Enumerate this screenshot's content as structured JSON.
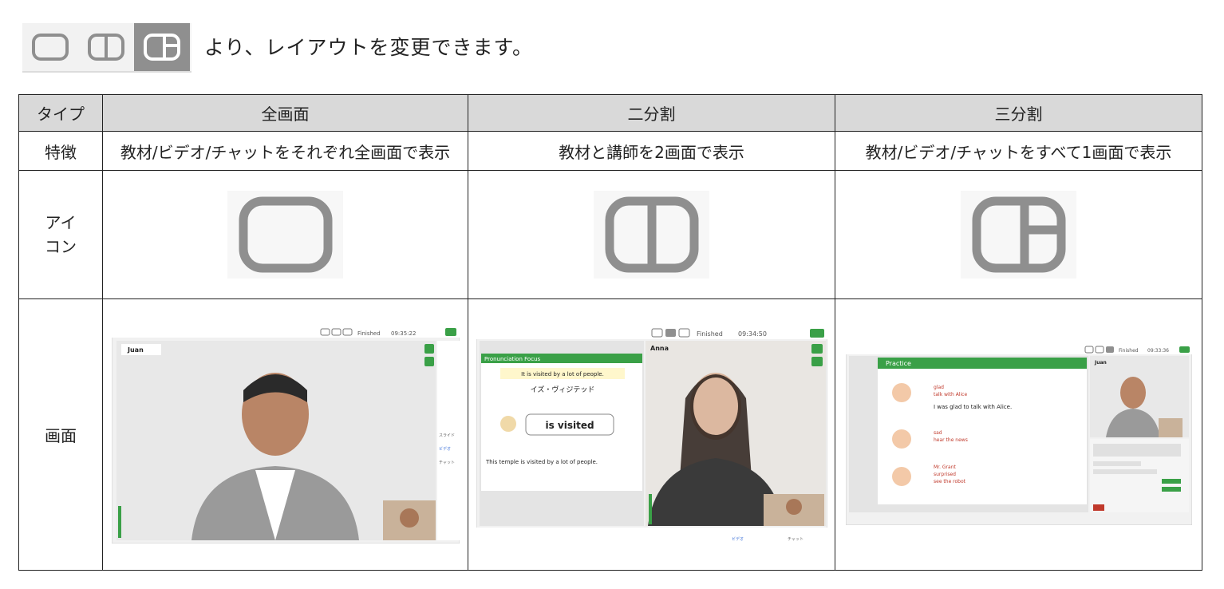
{
  "intro": {
    "text": "より、レイアウトを変更できます。"
  },
  "icons": [
    "single-pane-icon",
    "split-pane-icon",
    "triple-pane-icon"
  ],
  "colors": {
    "icon_gray": "#8f8f8f",
    "header_bg": "#d9d9d9",
    "app_green": "#3aa047"
  },
  "table": {
    "row_labels": {
      "type": "タイプ",
      "feature": "特徴",
      "icon": "アイコン",
      "screen": "画面"
    },
    "columns": [
      {
        "type": "全画面",
        "feature": "教材/ビデオ/チャットをそれぞれ全画面で表示"
      },
      {
        "type": "二分割",
        "feature": "教材と講師を2画面で表示"
      },
      {
        "type": "三分割",
        "feature": "教材/ビデオ/チャットをすべて1画面で表示"
      }
    ]
  },
  "screens": {
    "full": {
      "user": "Juan",
      "status": "Finished",
      "timer": "09:35:22",
      "side_slide": "スライド",
      "side_video": "ビデオ",
      "side_chat": "チャット"
    },
    "split": {
      "user": "Anna",
      "status": "Finished",
      "timer": "09:34:50",
      "section": "Pronunciation Focus",
      "sentence1": "It is visited by a lot of people.",
      "katakana": "イズ・ヴィジテッド",
      "bubble": "is visited",
      "sentence2": "This temple is visited by a lot of people.",
      "nav_video": "ビデオ",
      "nav_chat": "チャット"
    },
    "triple": {
      "user": "Juan",
      "status": "Finished",
      "timer": "09:33:36",
      "section": "Practice",
      "line1": "I was glad to talk with Alice.",
      "item1": "glad",
      "item2": "talk with Alice",
      "item3": "sad",
      "item4": "hear the news",
      "item5": "Mr. Grant",
      "item6": "surprised",
      "item7": "see the robot"
    }
  }
}
